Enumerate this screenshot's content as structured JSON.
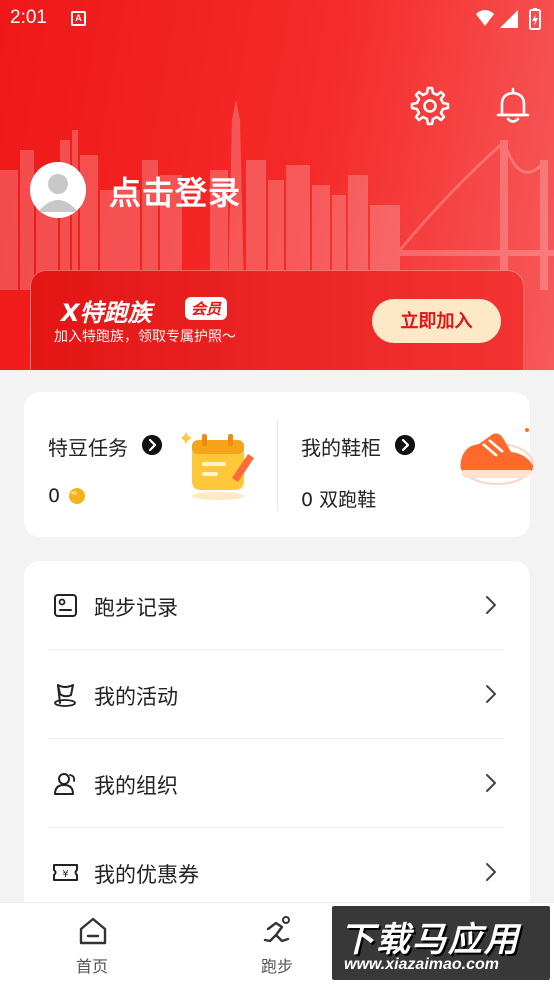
{
  "status_bar": {
    "time": "2:01",
    "notification_icon": "A"
  },
  "header": {
    "settings_icon": "gear-icon",
    "bell_icon": "bell-icon",
    "login_label": "点击登录"
  },
  "member": {
    "logo_text": "X特跑族",
    "logo_badge": "会员",
    "subtitle": "加入特跑族，领取专属护照～",
    "join_label": "立即加入"
  },
  "stats": {
    "tasks": {
      "title": "特豆任务",
      "value": "0"
    },
    "shoes": {
      "title": "我的鞋柜",
      "value": "0 双跑鞋"
    }
  },
  "menu": [
    {
      "label": "跑步记录",
      "icon": "run-record-icon"
    },
    {
      "label": "我的活动",
      "icon": "activity-flag-icon"
    },
    {
      "label": "我的组织",
      "icon": "group-icon"
    },
    {
      "label": "我的优惠券",
      "icon": "coupon-icon"
    }
  ],
  "tabbar": [
    {
      "label": "首页",
      "icon": "home-icon"
    },
    {
      "label": "跑步",
      "icon": "runner-icon"
    }
  ],
  "watermark": {
    "title": "下载马应用",
    "url": "www.xiazaimao.com"
  },
  "colors": {
    "brand_red": "#ef1818",
    "join_button_bg": "#fde8c8",
    "background": "#f3f3f3"
  }
}
